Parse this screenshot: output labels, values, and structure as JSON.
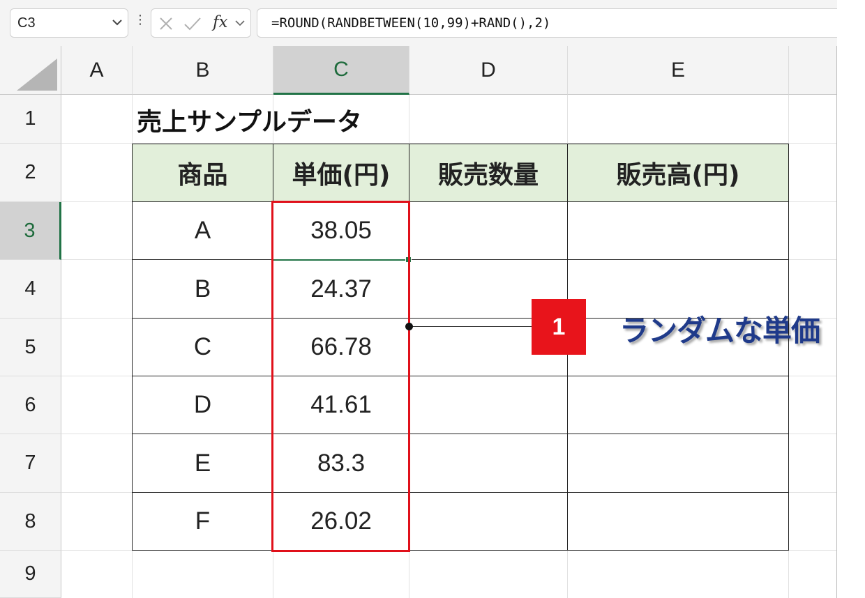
{
  "formula_bar": {
    "name_box": "C3",
    "formula": "=ROUND(RANDBETWEEN(10,99)+RAND(),2)",
    "fx_label": "fx"
  },
  "columns": [
    "A",
    "B",
    "C",
    "D",
    "E"
  ],
  "rows": [
    "1",
    "2",
    "3",
    "4",
    "5",
    "6",
    "7",
    "8",
    "9"
  ],
  "selected_column": "C",
  "selected_row": "3",
  "sheet": {
    "title": "売上サンプルデータ",
    "headers": [
      "商品",
      "単価(円)",
      "販売数量",
      "販売高(円)"
    ],
    "rows": [
      {
        "product": "A",
        "price": "38.05",
        "qty": "",
        "sales": ""
      },
      {
        "product": "B",
        "price": "24.37",
        "qty": "",
        "sales": ""
      },
      {
        "product": "C",
        "price": "66.78",
        "qty": "",
        "sales": ""
      },
      {
        "product": "D",
        "price": "41.61",
        "qty": "",
        "sales": ""
      },
      {
        "product": "E",
        "price": "83.3",
        "qty": "",
        "sales": ""
      },
      {
        "product": "F",
        "price": "26.02",
        "qty": "",
        "sales": ""
      }
    ]
  },
  "callout": {
    "badge": "1",
    "text": "ランダムな単価"
  },
  "colors": {
    "header_fill": "#e2efda",
    "highlight": "#e0101a",
    "callout_text": "#1f3a8a",
    "selection": "#217346"
  }
}
